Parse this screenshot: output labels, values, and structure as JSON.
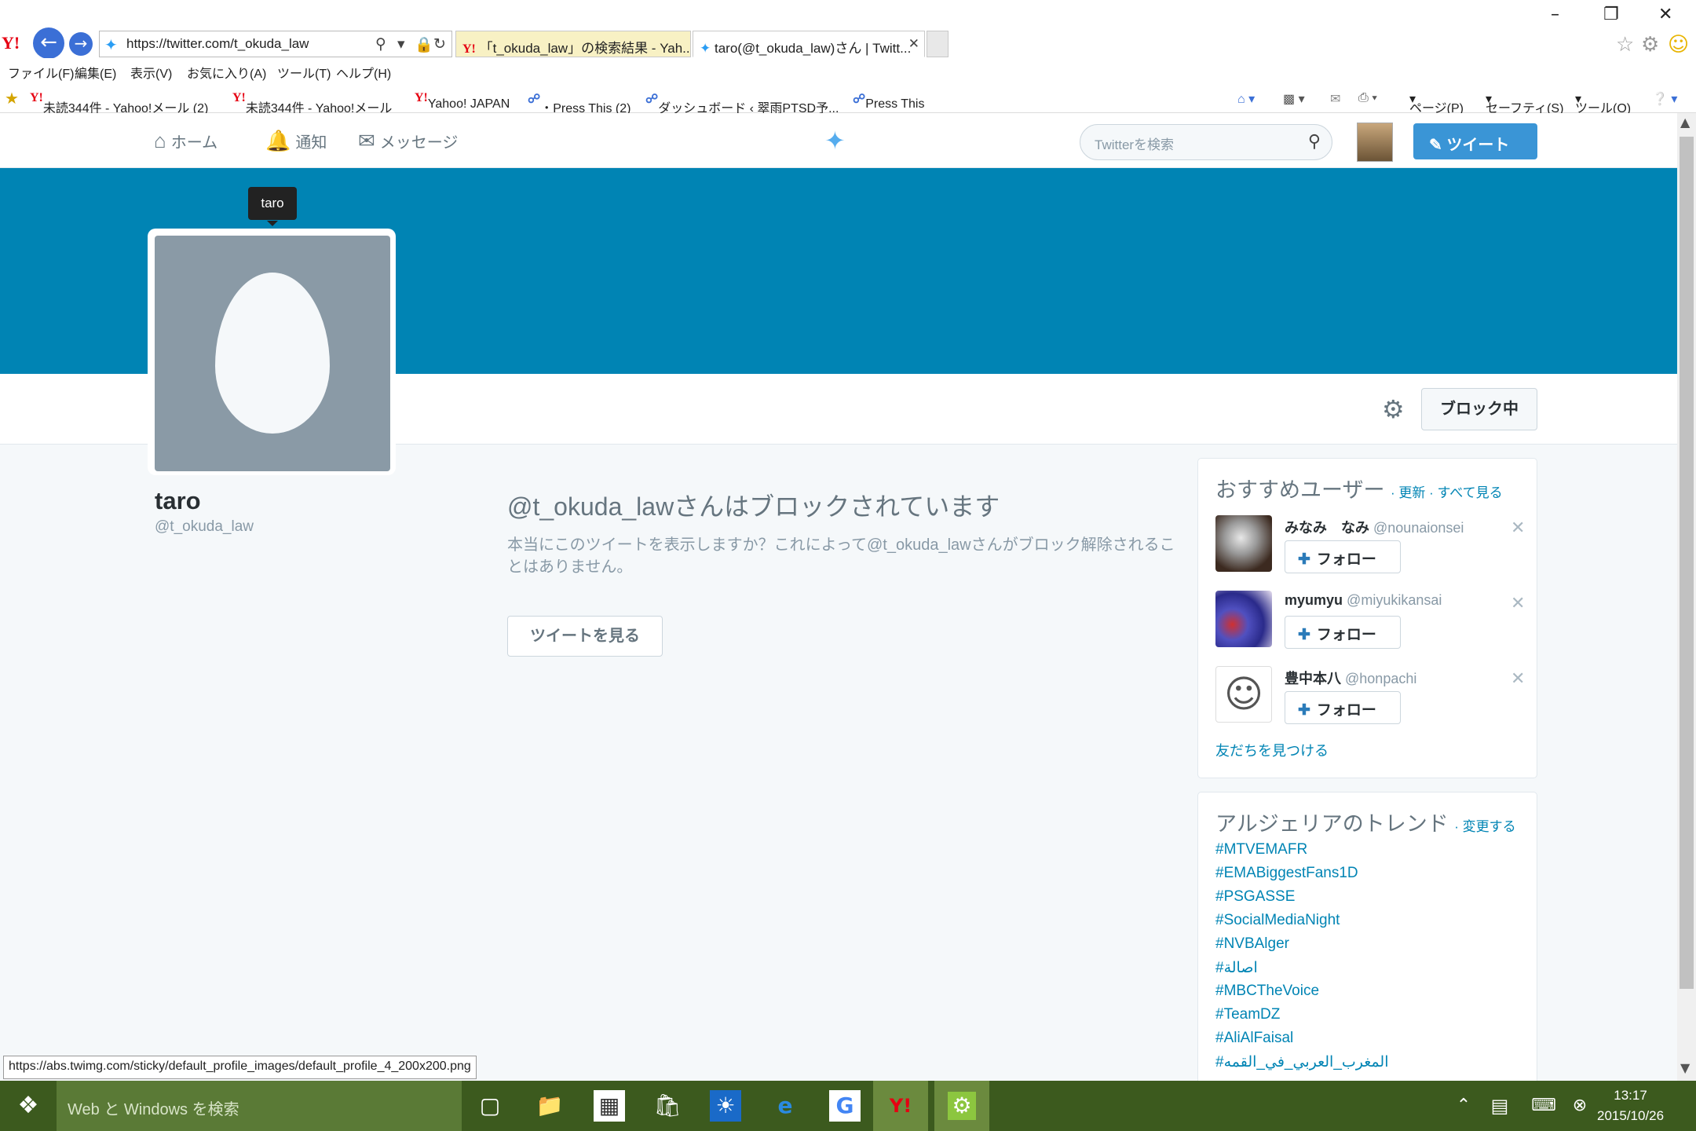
{
  "browser": {
    "address": "https://twitter.com/t_okuda_law",
    "tabs": [
      "「t_okuda_law」の検索結果 - Yah...",
      "taro(@t_okuda_law)さん | Twitt..."
    ],
    "menu": [
      "ファイル(F)",
      "編集(E)",
      "表示(V)",
      "お気に入り(A)",
      "ツール(T)",
      "ヘルプ(H)"
    ],
    "favorites": [
      "未読344件 - Yahoo!メール (2)",
      "未読344件 - Yahoo!メール",
      "Yahoo! JAPAN",
      "・Press This (2)",
      "ダッシュボード ‹ 翠雨PTSD予...",
      "Press This"
    ],
    "command_bar": [
      "ページ(P)",
      "セーフティ(S)",
      "ツール(O)"
    ],
    "status_url": "https://abs.twimg.com/sticky/default_profile_images/default_profile_4_200x200.png"
  },
  "twitter": {
    "nav": {
      "home": "ホーム",
      "notifications": "通知",
      "messages": "メッセージ"
    },
    "search_placeholder": "Twitterを検索",
    "tweet_button": "ツイート",
    "tooltip": "taro",
    "profile": {
      "name": "taro",
      "handle": "@t_okuda_law"
    },
    "blocked_button": "ブロック中",
    "blocked_title": "@t_okuda_lawさんはブロックされています",
    "blocked_desc": "本当にこのツイートを表示しますか？これによって@t_okuda_lawさんがブロック解除されることはありません。",
    "view_tweets_button": "ツイートを見る",
    "suggestions": {
      "title": "おすすめユーザー",
      "refresh": "更新",
      "view_all": "すべて見る",
      "users": [
        {
          "name": "みなみ　なみ",
          "handle": "@nounaionsei"
        },
        {
          "name": "myumyu",
          "handle": "@miyukikansai"
        },
        {
          "name": "豊中本八",
          "handle": "@honpachi"
        }
      ],
      "follow_label": "フォロー",
      "find_friends": "友だちを見つける"
    },
    "trends": {
      "title": "アルジェリアのトレンド",
      "change": "変更する",
      "items": [
        "#MTVEMAFR",
        "#EMABiggestFans1D",
        "#PSGASSE",
        "#SocialMediaNight",
        "#NVBAlger",
        "#اصالة",
        "#MBCTheVoice",
        "#TeamDZ",
        "#AliAlFaisal",
        "#المغرب_العربي_في_القمه"
      ]
    }
  },
  "taskbar": {
    "search_placeholder": "Web と Windows を検索",
    "time": "13:17",
    "date": "2015/10/26"
  }
}
